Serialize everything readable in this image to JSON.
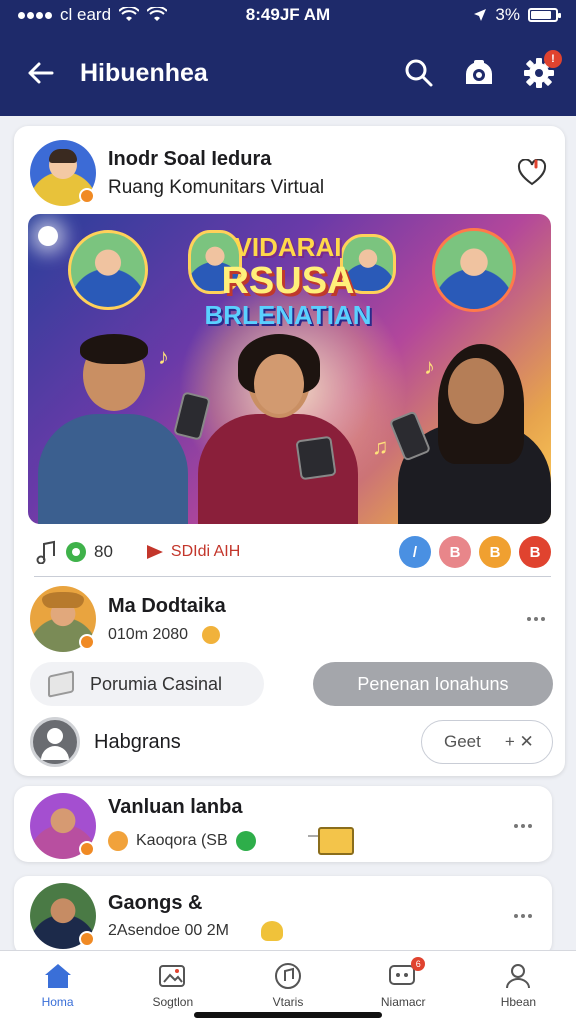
{
  "status_bar": {
    "carrier": "cl eard",
    "time": "8:49JF AM",
    "battery": "3%",
    "battery_level": 0.85
  },
  "header": {
    "title": "Hibuenhea",
    "icons": [
      "back-arrow-icon",
      "search-icon",
      "camera-icon",
      "gear-icon"
    ],
    "settings_badge": "!"
  },
  "main_post": {
    "author": "Inodr Soal Iedura",
    "subtitle": "Ruang Komunitars Virtual",
    "banner": {
      "line1": "VIDARAI",
      "line2": "RSUSA",
      "line3": "BRLENATIAN"
    },
    "actions": {
      "left_label": "80",
      "mid_label": "SDIdi AIH",
      "reactions": [
        "/",
        "B",
        "B",
        "B"
      ]
    }
  },
  "post2": {
    "name": "Ma Dodtaika",
    "meta": "010m 2080"
  },
  "pills": {
    "left": "Porumia Casinal",
    "right": "Penenan Ionahuns"
  },
  "invite": {
    "name": "Habgrans",
    "button": "Geet",
    "close": "+ ✕"
  },
  "card3": {
    "name": "Vanluan lanba",
    "meta": "Kaoqora (SB"
  },
  "card4": {
    "name": "Gaongs &",
    "meta": "2Asendoe 00 2M"
  },
  "bottom_nav": {
    "items": [
      {
        "label": "Homa",
        "icon": "home-icon",
        "active": true
      },
      {
        "label": "Sogtlon",
        "icon": "image-icon",
        "active": false
      },
      {
        "label": "Vtaris",
        "icon": "music-icon",
        "active": false
      },
      {
        "label": "Niamacr",
        "icon": "chat-icon",
        "active": false,
        "badge": "6"
      },
      {
        "label": "Hbean",
        "icon": "profile-icon",
        "active": false
      }
    ]
  },
  "colors": {
    "header_bg": "#1e2a6a",
    "accent": "#3a6fd8",
    "notify": "#e0432f"
  }
}
